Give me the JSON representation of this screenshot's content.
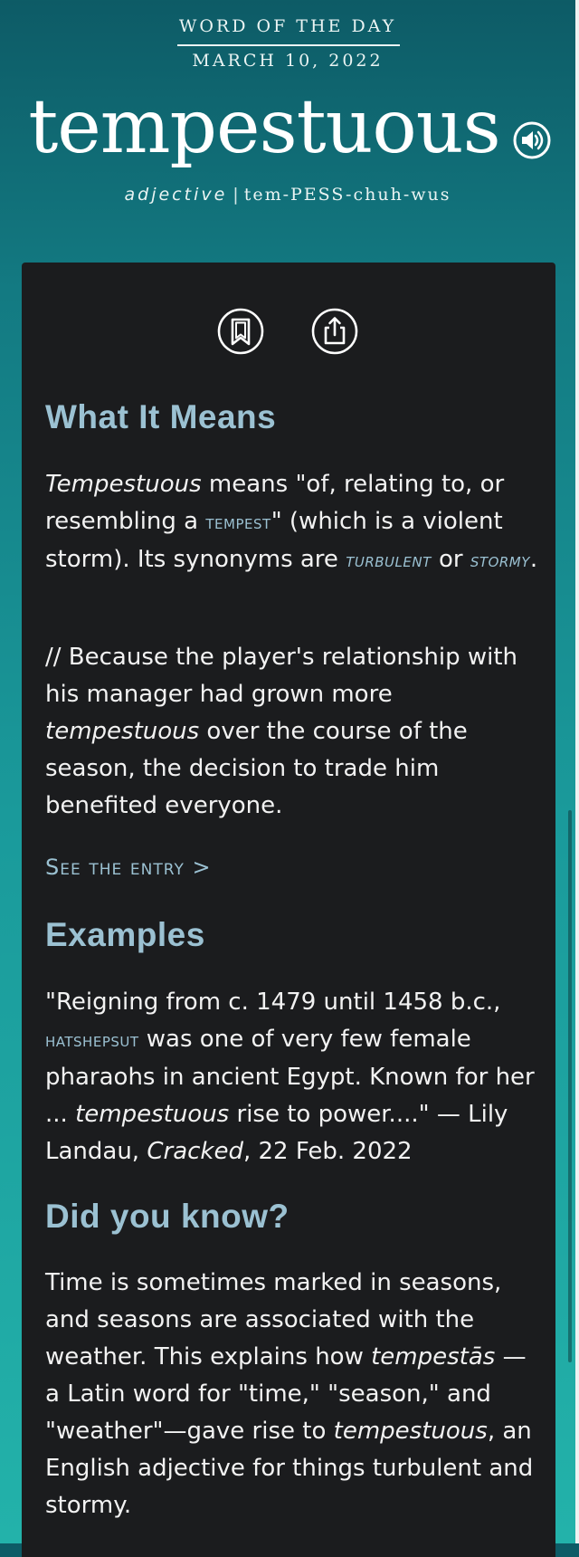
{
  "header": {
    "label": "WORD OF THE DAY",
    "date": "MARCH 10, 2022",
    "word": "tempestuous",
    "part_of_speech": "adjective",
    "separator": "|",
    "pronunciation": "tem-PESS-chuh-wus",
    "speaker_icon": "speaker-icon"
  },
  "actions": {
    "bookmark_icon": "bookmark-icon",
    "share_icon": "share-icon"
  },
  "meaning": {
    "heading": "What It Means",
    "def_word": "Tempestuous",
    "def_text_1": " means \"of, relating to, or resembling a ",
    "def_link": "tempest",
    "def_text_2": "\" (which is a violent storm). Its synonyms are ",
    "syn_1": "turbulent",
    "syn_or": " or ",
    "syn_2": "stormy",
    "syn_end": ".",
    "example_pre": "// Because the player's relationship with his manager had grown more ",
    "example_word": "tempestuous",
    "example_post": " over the course of the season, the decision to trade him benefited everyone.",
    "entry_link": "See the entry >"
  },
  "examples": {
    "heading": "Examples",
    "text_1": "\"Reigning from c. 1479 until 1458 b.c., ",
    "link": "Hatshepsut",
    "text_2": " was one of very few female pharaohs in ancient Egypt. Known for her ... ",
    "word": "tempestuous",
    "text_3": " rise to power....\" — Lily Landau, ",
    "source": "Cracked",
    "text_4": ", 22 Feb. 2022"
  },
  "did_you_know": {
    "heading": "Did you know?",
    "text_1": "Time is sometimes marked in seasons, and seasons are associated with the weather. This explains how ",
    "latin": "tempestās",
    "text_2": " —a Latin word for \"time,\" \"season,\" and \"weather\"—gave rise to ",
    "word": "tempestuous",
    "text_3": ", an English adjective for things turbulent and stormy."
  },
  "colors": {
    "accent": "#9bc1d2",
    "card": "#1b1c1e",
    "gradient_top": "#0d5b66",
    "gradient_bottom": "#23b2aa"
  }
}
